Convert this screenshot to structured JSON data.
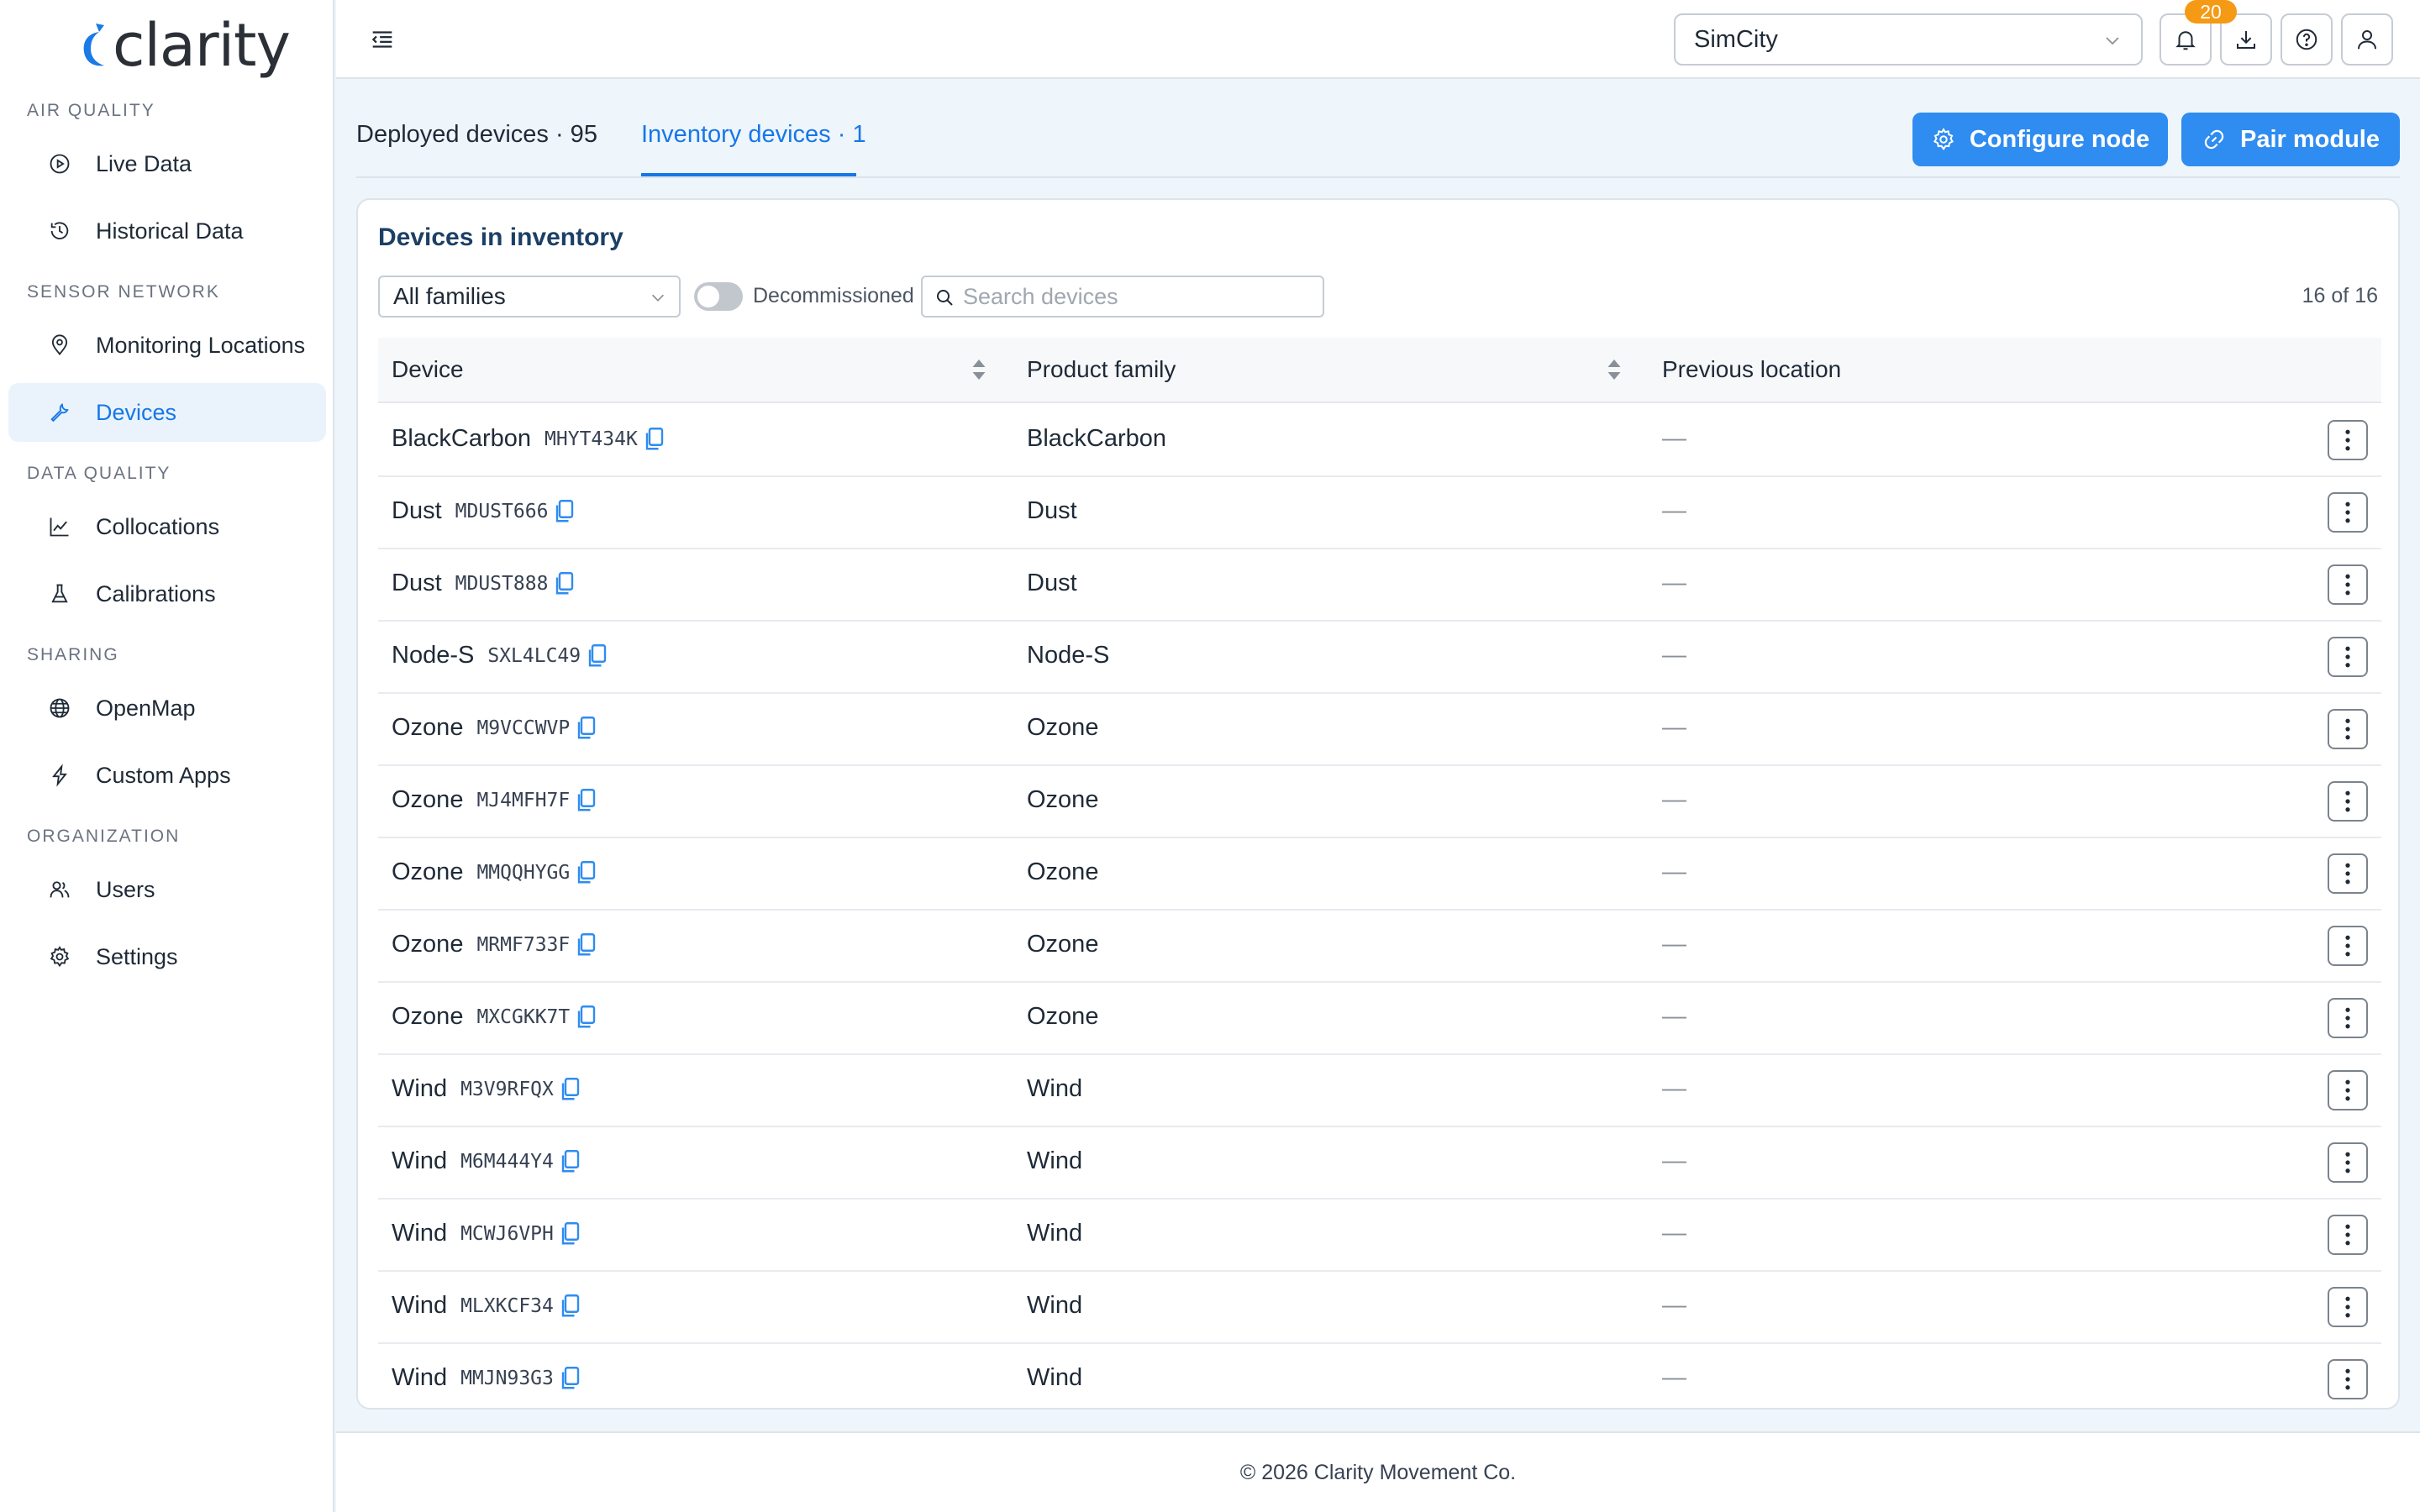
{
  "app": {
    "logo_text": "clarity"
  },
  "sidebar": {
    "sections": [
      {
        "label": "AIR QUALITY"
      },
      {
        "label": "SENSOR NETWORK"
      },
      {
        "label": "DATA QUALITY"
      },
      {
        "label": "SHARING"
      },
      {
        "label": "ORGANIZATION"
      }
    ],
    "items": [
      {
        "label": "Live Data",
        "icon": "play-circle-icon"
      },
      {
        "label": "Historical Data",
        "icon": "history-icon"
      },
      {
        "label": "Monitoring Locations",
        "icon": "location-pin-icon"
      },
      {
        "label": "Devices",
        "icon": "wrench-icon",
        "active": true
      },
      {
        "label": "Collocations",
        "icon": "line-chart-icon"
      },
      {
        "label": "Calibrations",
        "icon": "flask-icon"
      },
      {
        "label": "OpenMap",
        "icon": "globe-icon"
      },
      {
        "label": "Custom Apps",
        "icon": "lightning-icon"
      },
      {
        "label": "Users",
        "icon": "users-icon"
      },
      {
        "label": "Settings",
        "icon": "gear-icon"
      }
    ]
  },
  "header": {
    "org_select": {
      "value": "SimCity"
    },
    "notifications_count": "20",
    "icons": [
      "bell-icon",
      "download-icon",
      "help-icon",
      "user-icon"
    ]
  },
  "tabs": [
    {
      "label": "Deployed devices · 95",
      "active": false
    },
    {
      "label": "Inventory devices · 1",
      "active": true
    }
  ],
  "actions": {
    "configure_label": "Configure node",
    "pair_label": "Pair module"
  },
  "inventory": {
    "title": "Devices in inventory",
    "family_filter": "All families",
    "toggle_label": "Decommissioned",
    "toggle_on": false,
    "search_placeholder": "Search devices",
    "count": "16 of 16",
    "columns": [
      "Device",
      "Product family",
      "Previous location"
    ],
    "rows": [
      {
        "device": "BlackCarbon",
        "serial": "MHYT434K",
        "family": "BlackCarbon",
        "previous": "—"
      },
      {
        "device": "Dust",
        "serial": "MDUST666",
        "family": "Dust",
        "previous": "—"
      },
      {
        "device": "Dust",
        "serial": "MDUST888",
        "family": "Dust",
        "previous": "—"
      },
      {
        "device": "Node-S",
        "serial": "SXL4LC49",
        "family": "Node-S",
        "previous": "—"
      },
      {
        "device": "Ozone",
        "serial": "M9VCCWVP",
        "family": "Ozone",
        "previous": "—"
      },
      {
        "device": "Ozone",
        "serial": "MJ4MFH7F",
        "family": "Ozone",
        "previous": "—"
      },
      {
        "device": "Ozone",
        "serial": "MMQQHYGG",
        "family": "Ozone",
        "previous": "—"
      },
      {
        "device": "Ozone",
        "serial": "MRMF733F",
        "family": "Ozone",
        "previous": "—"
      },
      {
        "device": "Ozone",
        "serial": "MXCGKK7T",
        "family": "Ozone",
        "previous": "—"
      },
      {
        "device": "Wind",
        "serial": "M3V9RFQX",
        "family": "Wind",
        "previous": "—"
      },
      {
        "device": "Wind",
        "serial": "M6M444Y4",
        "family": "Wind",
        "previous": "—"
      },
      {
        "device": "Wind",
        "serial": "MCWJ6VPH",
        "family": "Wind",
        "previous": "—"
      },
      {
        "device": "Wind",
        "serial": "MLXKCF34",
        "family": "Wind",
        "previous": "—"
      },
      {
        "device": "Wind",
        "serial": "MMJN93G3",
        "family": "Wind",
        "previous": "—"
      }
    ]
  },
  "footer": {
    "text": "© 2026 Clarity Movement Co."
  },
  "colors": {
    "accent": "#2f8cf0",
    "badge": "#f59a14",
    "active_bg": "#eaf3fc",
    "title": "#1c3f66"
  }
}
